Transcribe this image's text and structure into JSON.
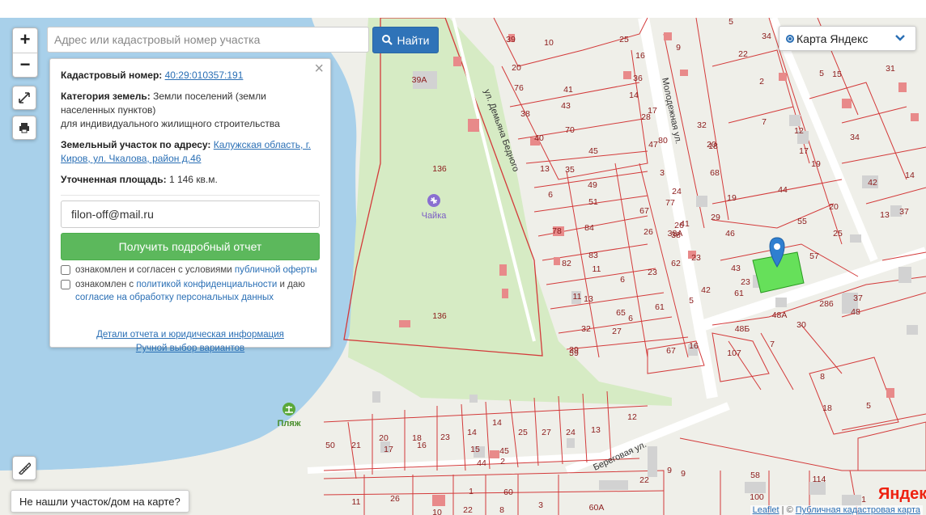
{
  "search": {
    "placeholder": "Адрес или кадастровый номер участка",
    "button_label": "Найти"
  },
  "layer_select": {
    "selected": "Карта Яндекс"
  },
  "info_panel": {
    "cadastral_label": "Кадастровый номер:",
    "cadastral_value": "40:29:010357:191",
    "category_label": "Категория земель:",
    "category_value": "Земли поселений (земли населенных пунктов)",
    "category_use": "для индивидуального жилищного строительства",
    "address_label": "Земельный участок по адресу:",
    "address_value": "Калужская область, г. Киров, ул. Чкалова, район д.46",
    "area_label": "Уточненная площадь:",
    "area_value": "1 146 кв.м.",
    "email_value": "filon-off@mail.ru",
    "report_button": "Получить подробный отчет",
    "offer_text": "ознакомлен и согласен с условиями",
    "offer_link": "публичной оферты",
    "privacy_text": "ознакомлен с",
    "privacy_link": "политикой конфиденциальности",
    "privacy_and": "и даю",
    "privacy_consent_link": "согласие на обработку персональных данных",
    "details_link": "Детали отчета и юридическая информация",
    "manual_link": "Ручной выбор вариантов"
  },
  "not_found_button": "Не нашли участок/дом на карте?",
  "attribution": {
    "leaflet": "Leaflet",
    "sep": " | © ",
    "pkk": "Публичная кадастровая карта"
  },
  "yandex_logo": {
    "first": "Я",
    "rest": "ндекс"
  },
  "map": {
    "streets": [
      {
        "name": "ул. Демьяна Бедного"
      },
      {
        "name": "Молодежная ул."
      },
      {
        "name": "Береговая ул."
      }
    ],
    "pois": [
      {
        "name": "Чайка",
        "icon": "airplane-icon"
      },
      {
        "name": "Пляж",
        "icon": "beach-icon"
      }
    ],
    "parcel_labels": [
      "39А",
      "136",
      "136",
      "59",
      "39",
      "10",
      "25",
      "16",
      "5",
      "9",
      "34",
      "36",
      "22",
      "2",
      "5",
      "15",
      "31",
      "20",
      "76",
      "41",
      "43",
      "70",
      "7",
      "14",
      "17",
      "28",
      "32",
      "18",
      "12",
      "17",
      "38",
      "40",
      "45",
      "47",
      "80",
      "20",
      "34",
      "13",
      "35",
      "49",
      "3",
      "68",
      "19",
      "14",
      "42",
      "13",
      "37",
      "39",
      "6",
      "51",
      "67",
      "77",
      "24",
      "38",
      "26",
      "29",
      "19",
      "44",
      "20",
      "55",
      "78",
      "84",
      "26",
      "38А",
      "41",
      "46",
      "25",
      "57",
      "82",
      "83",
      "11",
      "6",
      "23",
      "62",
      "23",
      "43",
      "23",
      "61",
      "11",
      "13",
      "65",
      "6",
      "61",
      "5",
      "42",
      "48Б",
      "48А",
      "30",
      "286",
      "48",
      "37",
      "32",
      "27",
      "67",
      "16",
      "107",
      "7",
      "8",
      "5",
      "18",
      "50",
      "21",
      "20",
      "17",
      "18",
      "16",
      "23",
      "14",
      "15",
      "14",
      "25",
      "27",
      "24",
      "13",
      "12",
      "45",
      "2",
      "44",
      "26",
      "11",
      "10",
      "22",
      "8",
      "3",
      "1",
      "60",
      "22",
      "9",
      "9",
      "60А",
      "58",
      "114",
      "100",
      "1"
    ]
  },
  "colors": {
    "water": "#a8d0ea",
    "green": "#d6ebc4",
    "selected": "#66e05a",
    "parcel_line": "#d33a3a",
    "building": "#e88a8a",
    "accent": "#2f73b8"
  }
}
